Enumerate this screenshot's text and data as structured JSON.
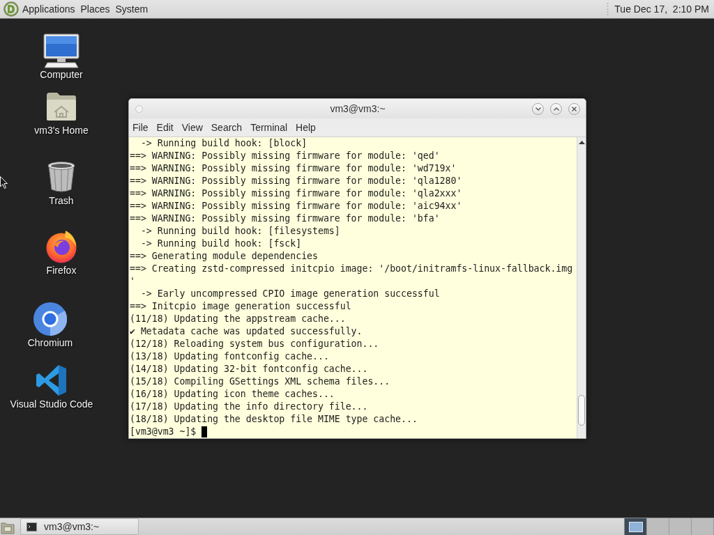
{
  "top_panel": {
    "menus": [
      "Applications",
      "Places",
      "System"
    ],
    "clock": "Tue Dec 17,  2:10 PM"
  },
  "desktop_icons": [
    {
      "kind": "computer",
      "label": "Computer"
    },
    {
      "kind": "home",
      "label": "vm3's Home"
    },
    {
      "kind": "trash",
      "label": "Trash"
    },
    {
      "kind": "firefox",
      "label": "Firefox"
    },
    {
      "kind": "chromium",
      "label": "Chromium"
    },
    {
      "kind": "vscode",
      "label": "Visual Studio Code"
    }
  ],
  "terminal_window": {
    "title": "vm3@vm3:~",
    "menu": [
      "File",
      "Edit",
      "View",
      "Search",
      "Terminal",
      "Help"
    ],
    "lines": [
      "  -> Running build hook: [block]",
      "==> WARNING: Possibly missing firmware for module: 'qed'",
      "==> WARNING: Possibly missing firmware for module: 'wd719x'",
      "==> WARNING: Possibly missing firmware for module: 'qla1280'",
      "==> WARNING: Possibly missing firmware for module: 'qla2xxx'",
      "==> WARNING: Possibly missing firmware for module: 'aic94xx'",
      "==> WARNING: Possibly missing firmware for module: 'bfa'",
      "  -> Running build hook: [filesystems]",
      "  -> Running build hook: [fsck]",
      "==> Generating module dependencies",
      "==> Creating zstd-compressed initcpio image: '/boot/initramfs-linux-fallback.img",
      "'",
      "  -> Early uncompressed CPIO image generation successful",
      "==> Initcpio image generation successful",
      "(11/18) Updating the appstream cache...",
      "✔ Metadata cache was updated successfully.",
      "(12/18) Reloading system bus configuration...",
      "(13/18) Updating fontconfig cache...",
      "(14/18) Updating 32-bit fontconfig cache...",
      "(15/18) Compiling GSettings XML schema files...",
      "(16/18) Updating icon theme caches...",
      "(17/18) Updating the info directory file...",
      "(18/18) Updating the desktop file MIME type cache..."
    ],
    "prompt": "[vm3@vm3 ~]$",
    "cursor": true
  },
  "bottom_panel": {
    "tasks": [
      {
        "label": "vm3@vm3:~"
      }
    ],
    "workspaces": [
      {
        "selected": true
      },
      {
        "selected": false
      },
      {
        "selected": false
      },
      {
        "selected": false
      }
    ]
  }
}
